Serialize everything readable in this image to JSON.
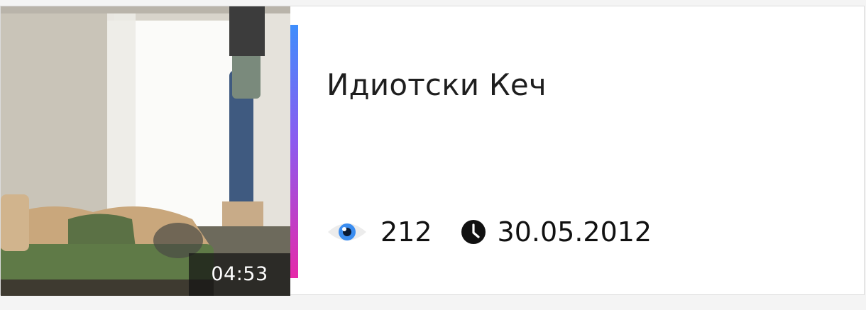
{
  "video": {
    "title": "Идиотски Кеч",
    "duration": "04:53",
    "views": "212",
    "date": "30.05.2012"
  },
  "icons": {
    "views": "eye-icon",
    "date": "clock-icon"
  },
  "colors": {
    "accent_top": "#3f8efc",
    "accent_mid": "#8a5cf0",
    "accent_bottom": "#e62aa9",
    "eye_iris": "#3b8df0"
  }
}
